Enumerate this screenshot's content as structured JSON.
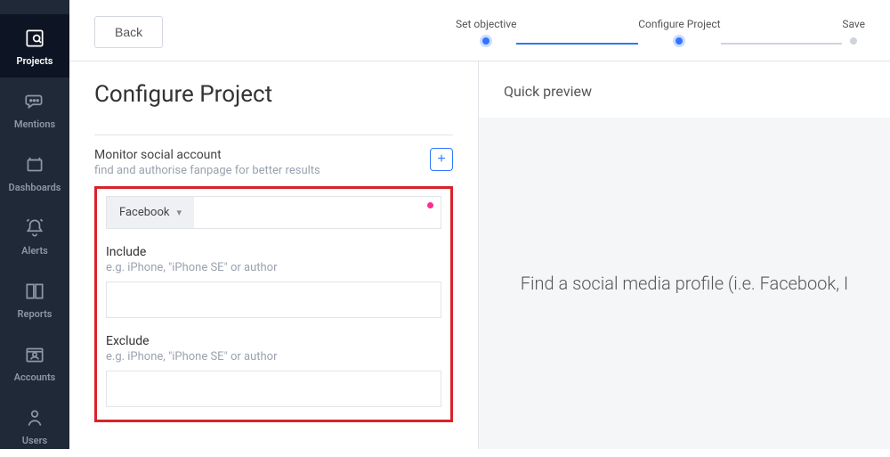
{
  "sidebar": {
    "items": [
      {
        "label": "Projects"
      },
      {
        "label": "Mentions"
      },
      {
        "label": "Dashboards"
      },
      {
        "label": "Alerts"
      },
      {
        "label": "Reports"
      },
      {
        "label": "Accounts"
      },
      {
        "label": "Users"
      }
    ]
  },
  "topbar": {
    "back_label": "Back"
  },
  "stepper": {
    "step1": "Set objective",
    "step2": "Configure Project",
    "step3": "Save"
  },
  "page": {
    "title": "Configure Project"
  },
  "monitor": {
    "title": "Monitor social account",
    "subtitle": "find and authorise fanpage for better results",
    "add_label": "+",
    "source_selected": "Facebook",
    "include_label": "Include",
    "include_hint": "e.g. iPhone, \"iPhone SE\" or author",
    "exclude_label": "Exclude",
    "exclude_hint": "e.g. iPhone, \"iPhone SE\" or author"
  },
  "preview": {
    "title": "Quick preview",
    "body": "Find a social media profile (i.e. Facebook, I"
  }
}
